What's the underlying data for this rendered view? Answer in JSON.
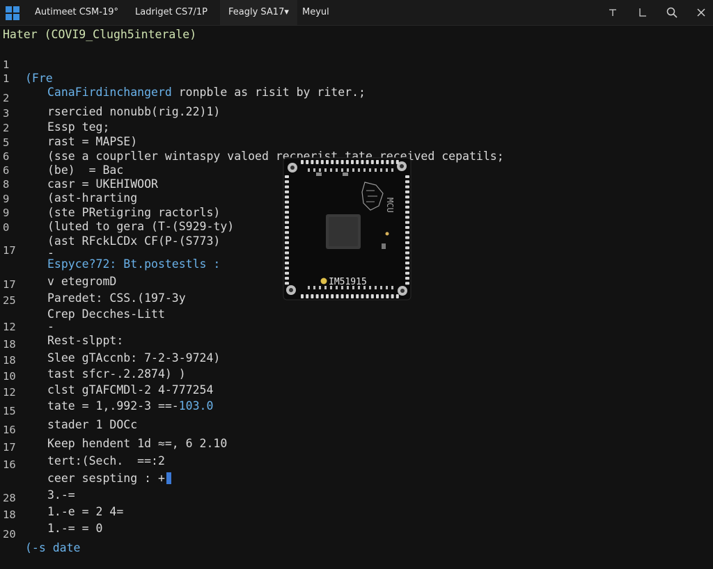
{
  "titlebar": {
    "tabs": [
      {
        "label": "Autimeet CSM-19°",
        "active": false
      },
      {
        "label": "Ladriget CS7/1P",
        "active": false
      },
      {
        "label": "Feagly SA17▾",
        "active": true
      },
      {
        "label": "Meyul",
        "active": false
      }
    ],
    "controls": [
      "tau-icon",
      "corner-icon",
      "search-icon",
      "close-icon"
    ]
  },
  "editor": {
    "header": "Hater (COVI9_Clugh5interale)",
    "lines": [
      {
        "num": "1",
        "text": "(Fre",
        "color": "blue",
        "indent": false
      },
      {
        "num": "1",
        "text": "CanaFirdinchangerd ronpble as risit by riter.;",
        "color": "mixed",
        "indent": true
      },
      {
        "num": "2",
        "text": "rsercied nonubb(rig.22)1)",
        "color": "default",
        "indent": true
      },
      {
        "num": "3",
        "text": "Essp teg;",
        "color": "default",
        "indent": true
      },
      {
        "num": "2",
        "text": "rast = MAPSE)",
        "color": "default",
        "indent": true
      },
      {
        "num": "5",
        "text": "(sse a couprller wintaspy valoed recperist tate received cepatils;",
        "color": "default",
        "indent": true
      },
      {
        "num": "6",
        "text": "(be)  = Bac",
        "color": "default",
        "indent": true
      },
      {
        "num": "6",
        "text": "casr = UKEHIWOOR",
        "color": "default",
        "indent": true
      },
      {
        "num": "8",
        "text": "(ast-hrarting",
        "color": "default",
        "indent": true
      },
      {
        "num": "9",
        "text": "(ste PRetigring ractorls)",
        "color": "default",
        "indent": true
      },
      {
        "num": "9",
        "text": "(luted to gera (T-(S929-ty)",
        "color": "default",
        "indent": true
      },
      {
        "num": "0",
        "text": "(ast RFckLCDx CF(P-(S773)",
        "color": "default",
        "indent": true
      },
      {
        "num": "",
        "text": "-",
        "color": "default",
        "indent": true
      },
      {
        "num": "17",
        "text": "Espyce?72: Bt.postestls :",
        "color": "blue",
        "indent": true
      },
      {
        "num": "",
        "text": "v etegromD",
        "color": "default",
        "indent": true
      },
      {
        "num": "17",
        "text": "Paredet: CSS.(197-3y",
        "color": "default",
        "indent": true
      },
      {
        "num": "25",
        "text": "Crep Decches-Litt",
        "color": "default",
        "indent": true
      },
      {
        "num": "",
        "text": "-",
        "color": "default",
        "indent": true
      },
      {
        "num": "12",
        "text": "Rest-slppt:",
        "color": "default",
        "indent": true
      },
      {
        "num": "18",
        "text": "Slee gTAccnb: 7-2-3-9724)",
        "color": "default",
        "indent": true
      },
      {
        "num": "18",
        "text": "tast sfcr-.2.2874) )",
        "color": "default",
        "indent": true
      },
      {
        "num": "10",
        "text": "clst gTAFCMDl-2 4-777254",
        "color": "default",
        "indent": true
      },
      {
        "num": "12",
        "text": "tate = 1,.992-3 ==-103.0",
        "color": "mixed",
        "indent": true
      },
      {
        "num": "15",
        "text": "stader 1 DOCc",
        "color": "default",
        "indent": true
      },
      {
        "num": "16",
        "text": "Keep hendent 1d ≈=, 6 2.10",
        "color": "default",
        "indent": true
      },
      {
        "num": "17",
        "text": "tert:(Sech.  ==:2",
        "color": "default",
        "indent": true
      },
      {
        "num": "16",
        "text": "ceer sespting : +",
        "color": "default",
        "indent": true
      },
      {
        "num": "",
        "text": "3.-=",
        "color": "default",
        "indent": true
      },
      {
        "num": "28",
        "text": "1.-e = 2 4=",
        "color": "default",
        "indent": true
      },
      {
        "num": "18",
        "text": "1.-= = 0",
        "color": "default",
        "indent": true
      },
      {
        "num": "20",
        "text": "(-s date",
        "color": "blue",
        "indent": false
      }
    ],
    "mixed_parts": {
      "line2_blue": "CanaFirdinchangerd",
      "line2_rest": " ronpble as risit by riter.;",
      "line23_rest": "tate = 1,.992-3 ==-",
      "line23_blue": "103.0"
    }
  },
  "board_image": {
    "label": "IM51915",
    "icon": "microcontroller-board-image"
  },
  "colors": {
    "background": "#121212",
    "titlebar": "#1a1a1a",
    "text": "#d9d9d9",
    "keyword_blue": "#6ab2ea",
    "header_green": "#cfe3b0",
    "cursor": "#3b79d6"
  }
}
